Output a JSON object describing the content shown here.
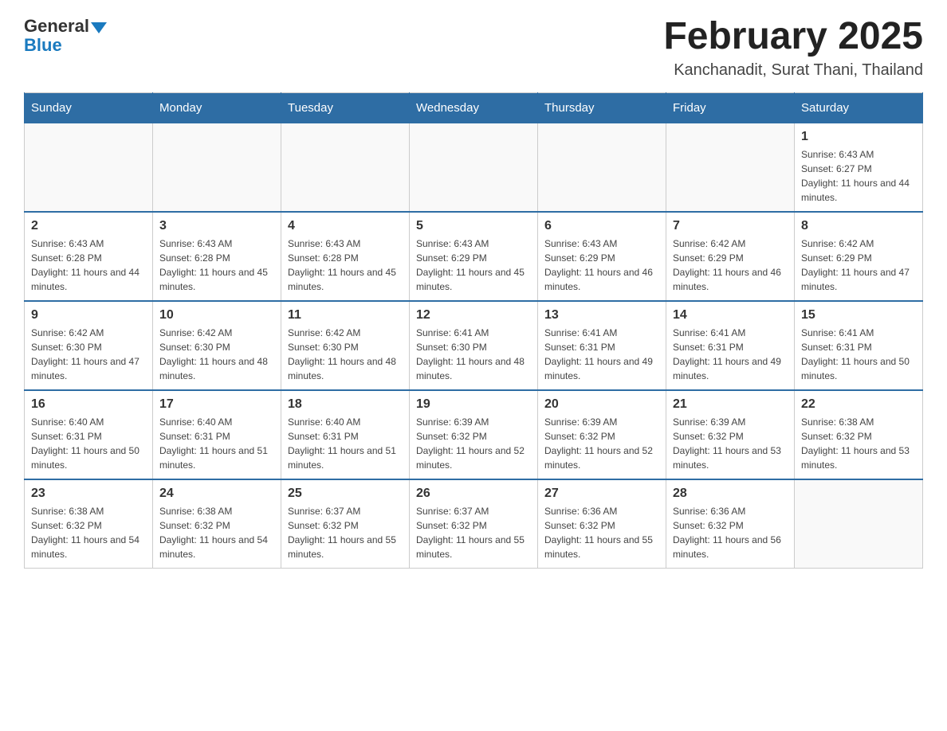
{
  "header": {
    "logo_general": "General",
    "logo_blue": "Blue",
    "month_title": "February 2025",
    "location": "Kanchanadit, Surat Thani, Thailand"
  },
  "days_of_week": [
    "Sunday",
    "Monday",
    "Tuesday",
    "Wednesday",
    "Thursday",
    "Friday",
    "Saturday"
  ],
  "weeks": [
    [
      {
        "day": "",
        "sunrise": "",
        "sunset": "",
        "daylight": ""
      },
      {
        "day": "",
        "sunrise": "",
        "sunset": "",
        "daylight": ""
      },
      {
        "day": "",
        "sunrise": "",
        "sunset": "",
        "daylight": ""
      },
      {
        "day": "",
        "sunrise": "",
        "sunset": "",
        "daylight": ""
      },
      {
        "day": "",
        "sunrise": "",
        "sunset": "",
        "daylight": ""
      },
      {
        "day": "",
        "sunrise": "",
        "sunset": "",
        "daylight": ""
      },
      {
        "day": "1",
        "sunrise": "Sunrise: 6:43 AM",
        "sunset": "Sunset: 6:27 PM",
        "daylight": "Daylight: 11 hours and 44 minutes."
      }
    ],
    [
      {
        "day": "2",
        "sunrise": "Sunrise: 6:43 AM",
        "sunset": "Sunset: 6:28 PM",
        "daylight": "Daylight: 11 hours and 44 minutes."
      },
      {
        "day": "3",
        "sunrise": "Sunrise: 6:43 AM",
        "sunset": "Sunset: 6:28 PM",
        "daylight": "Daylight: 11 hours and 45 minutes."
      },
      {
        "day": "4",
        "sunrise": "Sunrise: 6:43 AM",
        "sunset": "Sunset: 6:28 PM",
        "daylight": "Daylight: 11 hours and 45 minutes."
      },
      {
        "day": "5",
        "sunrise": "Sunrise: 6:43 AM",
        "sunset": "Sunset: 6:29 PM",
        "daylight": "Daylight: 11 hours and 45 minutes."
      },
      {
        "day": "6",
        "sunrise": "Sunrise: 6:43 AM",
        "sunset": "Sunset: 6:29 PM",
        "daylight": "Daylight: 11 hours and 46 minutes."
      },
      {
        "day": "7",
        "sunrise": "Sunrise: 6:42 AM",
        "sunset": "Sunset: 6:29 PM",
        "daylight": "Daylight: 11 hours and 46 minutes."
      },
      {
        "day": "8",
        "sunrise": "Sunrise: 6:42 AM",
        "sunset": "Sunset: 6:29 PM",
        "daylight": "Daylight: 11 hours and 47 minutes."
      }
    ],
    [
      {
        "day": "9",
        "sunrise": "Sunrise: 6:42 AM",
        "sunset": "Sunset: 6:30 PM",
        "daylight": "Daylight: 11 hours and 47 minutes."
      },
      {
        "day": "10",
        "sunrise": "Sunrise: 6:42 AM",
        "sunset": "Sunset: 6:30 PM",
        "daylight": "Daylight: 11 hours and 48 minutes."
      },
      {
        "day": "11",
        "sunrise": "Sunrise: 6:42 AM",
        "sunset": "Sunset: 6:30 PM",
        "daylight": "Daylight: 11 hours and 48 minutes."
      },
      {
        "day": "12",
        "sunrise": "Sunrise: 6:41 AM",
        "sunset": "Sunset: 6:30 PM",
        "daylight": "Daylight: 11 hours and 48 minutes."
      },
      {
        "day": "13",
        "sunrise": "Sunrise: 6:41 AM",
        "sunset": "Sunset: 6:31 PM",
        "daylight": "Daylight: 11 hours and 49 minutes."
      },
      {
        "day": "14",
        "sunrise": "Sunrise: 6:41 AM",
        "sunset": "Sunset: 6:31 PM",
        "daylight": "Daylight: 11 hours and 49 minutes."
      },
      {
        "day": "15",
        "sunrise": "Sunrise: 6:41 AM",
        "sunset": "Sunset: 6:31 PM",
        "daylight": "Daylight: 11 hours and 50 minutes."
      }
    ],
    [
      {
        "day": "16",
        "sunrise": "Sunrise: 6:40 AM",
        "sunset": "Sunset: 6:31 PM",
        "daylight": "Daylight: 11 hours and 50 minutes."
      },
      {
        "day": "17",
        "sunrise": "Sunrise: 6:40 AM",
        "sunset": "Sunset: 6:31 PM",
        "daylight": "Daylight: 11 hours and 51 minutes."
      },
      {
        "day": "18",
        "sunrise": "Sunrise: 6:40 AM",
        "sunset": "Sunset: 6:31 PM",
        "daylight": "Daylight: 11 hours and 51 minutes."
      },
      {
        "day": "19",
        "sunrise": "Sunrise: 6:39 AM",
        "sunset": "Sunset: 6:32 PM",
        "daylight": "Daylight: 11 hours and 52 minutes."
      },
      {
        "day": "20",
        "sunrise": "Sunrise: 6:39 AM",
        "sunset": "Sunset: 6:32 PM",
        "daylight": "Daylight: 11 hours and 52 minutes."
      },
      {
        "day": "21",
        "sunrise": "Sunrise: 6:39 AM",
        "sunset": "Sunset: 6:32 PM",
        "daylight": "Daylight: 11 hours and 53 minutes."
      },
      {
        "day": "22",
        "sunrise": "Sunrise: 6:38 AM",
        "sunset": "Sunset: 6:32 PM",
        "daylight": "Daylight: 11 hours and 53 minutes."
      }
    ],
    [
      {
        "day": "23",
        "sunrise": "Sunrise: 6:38 AM",
        "sunset": "Sunset: 6:32 PM",
        "daylight": "Daylight: 11 hours and 54 minutes."
      },
      {
        "day": "24",
        "sunrise": "Sunrise: 6:38 AM",
        "sunset": "Sunset: 6:32 PM",
        "daylight": "Daylight: 11 hours and 54 minutes."
      },
      {
        "day": "25",
        "sunrise": "Sunrise: 6:37 AM",
        "sunset": "Sunset: 6:32 PM",
        "daylight": "Daylight: 11 hours and 55 minutes."
      },
      {
        "day": "26",
        "sunrise": "Sunrise: 6:37 AM",
        "sunset": "Sunset: 6:32 PM",
        "daylight": "Daylight: 11 hours and 55 minutes."
      },
      {
        "day": "27",
        "sunrise": "Sunrise: 6:36 AM",
        "sunset": "Sunset: 6:32 PM",
        "daylight": "Daylight: 11 hours and 55 minutes."
      },
      {
        "day": "28",
        "sunrise": "Sunrise: 6:36 AM",
        "sunset": "Sunset: 6:32 PM",
        "daylight": "Daylight: 11 hours and 56 minutes."
      },
      {
        "day": "",
        "sunrise": "",
        "sunset": "",
        "daylight": ""
      }
    ]
  ]
}
